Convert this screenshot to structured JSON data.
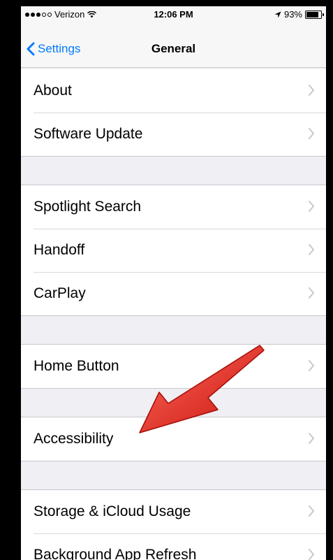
{
  "status_bar": {
    "carrier": "Verizon",
    "time": "12:06 PM",
    "battery": "93%",
    "battery_level": 0.93
  },
  "nav": {
    "back_label": "Settings",
    "title": "General"
  },
  "groups": [
    {
      "items": [
        {
          "label": "About"
        },
        {
          "label": "Software Update"
        }
      ]
    },
    {
      "items": [
        {
          "label": "Spotlight Search"
        },
        {
          "label": "Handoff"
        },
        {
          "label": "CarPlay"
        }
      ]
    },
    {
      "items": [
        {
          "label": "Home Button"
        }
      ]
    },
    {
      "items": [
        {
          "label": "Accessibility"
        }
      ]
    },
    {
      "items": [
        {
          "label": "Storage & iCloud Usage"
        },
        {
          "label": "Background App Refresh"
        }
      ]
    }
  ],
  "annotation": {
    "arrow_color": "#e0201a",
    "target": "Accessibility"
  },
  "colors": {
    "accent": "#007aff",
    "background": "#efeff4"
  }
}
